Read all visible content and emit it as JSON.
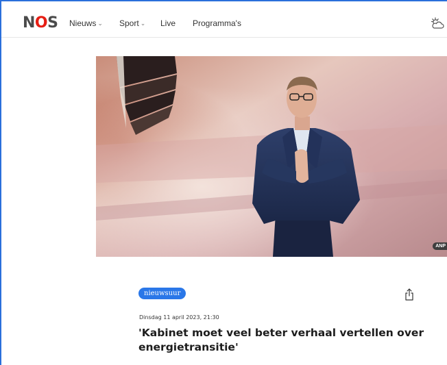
{
  "header": {
    "logo_text": "NOS",
    "nav": [
      {
        "label": "Nieuws",
        "has_dropdown": true
      },
      {
        "label": "Sport",
        "has_dropdown": true
      },
      {
        "label": "Live",
        "has_dropdown": false
      },
      {
        "label": "Programma's",
        "has_dropdown": false
      }
    ],
    "weather_icon": "partly-cloudy-icon",
    "brand_color": "#e61e14"
  },
  "article": {
    "image_icon": "speaker-on-stage-photo",
    "image_credit": "ANP",
    "tag": "nieuwsuur",
    "tag_color": "#2a77e8",
    "share_icon": "share-icon",
    "date": "Dinsdag 11 april 2023, 21:30",
    "title": "'Kabinet moet veel beter verhaal vertellen over energietransitie'"
  }
}
